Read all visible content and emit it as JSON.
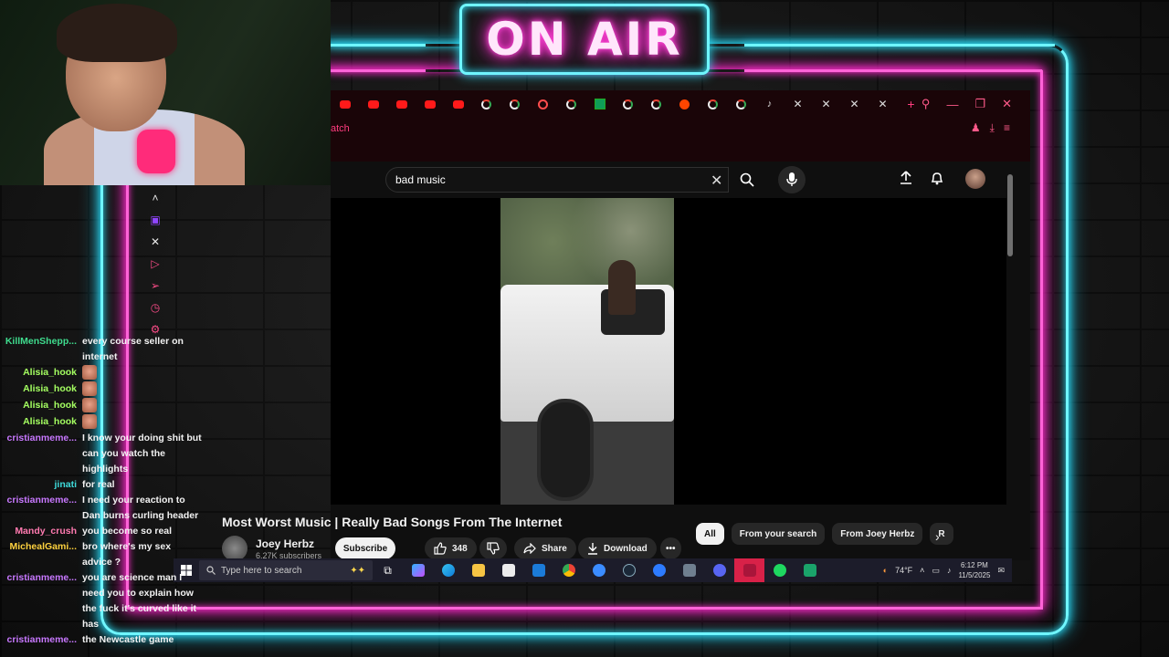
{
  "overlay": {
    "on_air_text": "ON AIR"
  },
  "browser": {
    "address_fragment": "atch",
    "tabs": [
      "yt",
      "yt",
      "yt",
      "yt",
      "yt",
      "g",
      "g",
      "rss",
      "g",
      "grid",
      "g",
      "g",
      "rd",
      "g",
      "g",
      "tt",
      "x",
      "x",
      "x",
      "x",
      "plus"
    ]
  },
  "youtube": {
    "search_value": "bad music",
    "video_title": "Most Worst Music | Really Bad Songs From The Internet",
    "channel": {
      "name": "Joey Herbz",
      "subscribers": "6.27K subscribers"
    },
    "subscribe_label": "Subscribe",
    "like_count": "348",
    "share_label": "Share",
    "download_label": "Download",
    "more_label": "•••",
    "filter_chips": [
      "All",
      "From your search",
      "From Joey Herbz",
      "R"
    ]
  },
  "taskbar": {
    "search_placeholder": "Type here to search",
    "weather": "74°F",
    "time": "6:12 PM",
    "date": "11/5/2025",
    "notification_count": "1"
  },
  "chat": [
    {
      "user": "KillMenShepp...",
      "color": "#3fdc8e",
      "lines": [
        "every course seller on",
        "internet"
      ]
    },
    {
      "user": "Alisia_hook",
      "color": "#a4ff61",
      "emote": true
    },
    {
      "user": "Alisia_hook",
      "color": "#a4ff61",
      "emote": true
    },
    {
      "user": "Alisia_hook",
      "color": "#a4ff61",
      "emote": true
    },
    {
      "user": "Alisia_hook",
      "color": "#a4ff61",
      "emote": true
    },
    {
      "user": "cristianmeme...",
      "color": "#c878ff",
      "lines": [
        "I know your doing shit but",
        "can you watch the",
        "highlights"
      ]
    },
    {
      "user": "jinati",
      "color": "#3fdcdc",
      "lines": [
        "for real"
      ]
    },
    {
      "user": "cristianmeme...",
      "color": "#c878ff",
      "lines": [
        "I need your reaction to",
        "Dan burns curling header"
      ]
    },
    {
      "user": "Mandy_crush",
      "color": "#ff7ab0",
      "lines": [
        "you become so real"
      ]
    },
    {
      "user": "MichealGami...",
      "color": "#ffd23f",
      "lines": [
        "bro where's my sex",
        "advice ?"
      ]
    },
    {
      "user": "cristianmeme...",
      "color": "#c878ff",
      "lines": [
        "you are science man I",
        "need you to explain how",
        "the fuck it's curved like it",
        "has"
      ]
    },
    {
      "user": "cristianmeme...",
      "color": "#c878ff",
      "lines": [
        "the Newcastle game"
      ]
    }
  ]
}
